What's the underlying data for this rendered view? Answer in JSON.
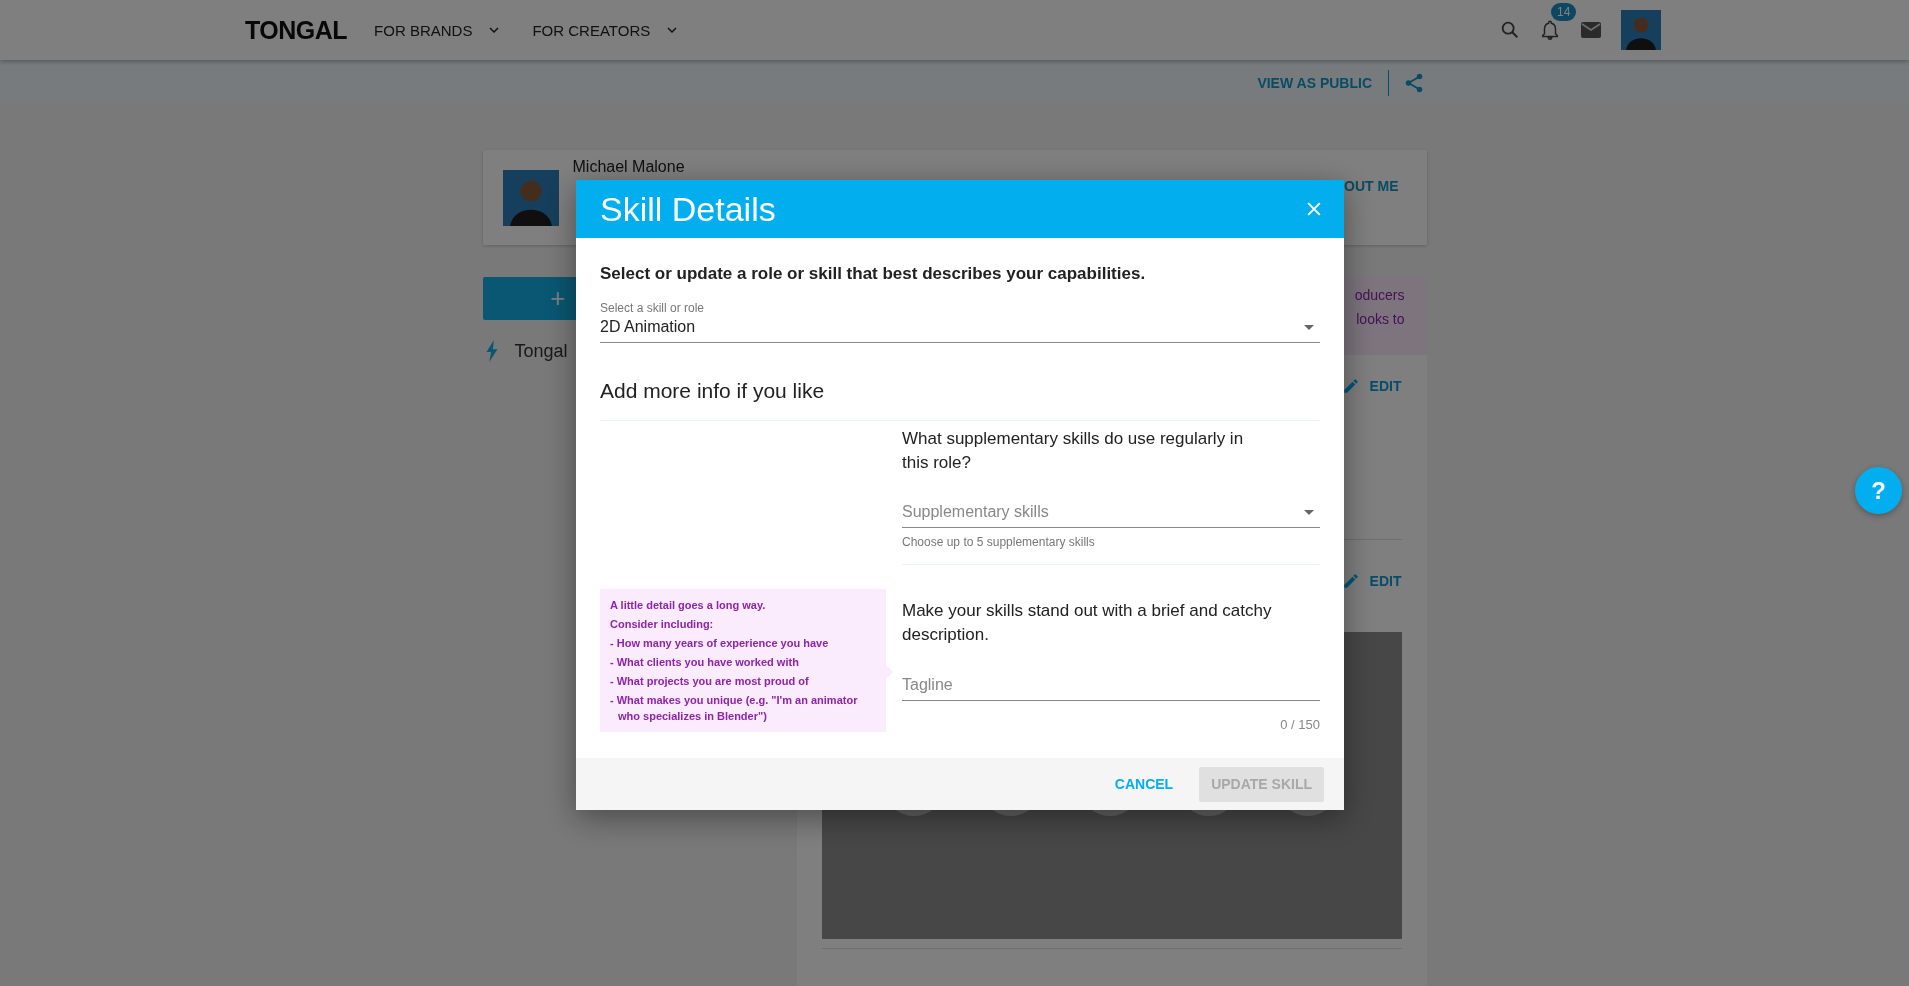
{
  "header": {
    "logo": "TONGAL",
    "nav": [
      {
        "label": "FOR BRANDS"
      },
      {
        "label": "FOR CREATORS"
      }
    ],
    "notification_count": "14"
  },
  "subbar": {
    "link": "VIEW AS PUBLIC"
  },
  "profile": {
    "name": "Michael Malone",
    "action": "OUT ME"
  },
  "sidebar": {
    "add_button": "+",
    "items": [
      {
        "label": "Tongal"
      }
    ]
  },
  "content": {
    "note_lines": [
      "oducers",
      "looks to"
    ],
    "sections": [
      {
        "action": "EDIT",
        "media": false
      },
      {
        "action": "EDIT",
        "media": true
      }
    ]
  },
  "help_button": "?",
  "dialog": {
    "title": "Skill Details",
    "intro": "Select or update a role or skill that best describes your capabilities.",
    "role_field": {
      "label": "Select a skill or role",
      "value": "2D Animation"
    },
    "subheading": "Add more info if you like",
    "tip": {
      "lines": [
        "A little detail goes a long way.",
        "Consider including:"
      ],
      "bullets": [
        "- How many years of experience you have",
        "- What clients you have worked with",
        "- What projects you are most proud of",
        "- What makes you unique (e.g. \"I'm an animator who specializes in Blender\")"
      ]
    },
    "skills_question": "What supplementary skills do use regularly in this role?",
    "skills_field": {
      "placeholder": "Supplementary skills",
      "helper": "Choose up to 5 supplementary skills"
    },
    "tagline_question": "Make your skills stand out with a brief and catchy description.",
    "tagline_field": {
      "placeholder": "Tagline",
      "counter": "0 / 150"
    },
    "buttons": [
      {
        "label": "CANCEL",
        "disabled": false
      },
      {
        "label": "UPDATE SKILL",
        "disabled": true
      }
    ]
  }
}
